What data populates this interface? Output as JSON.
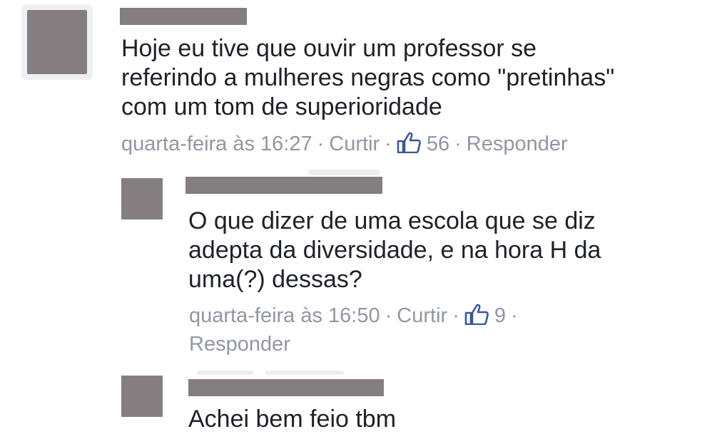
{
  "comments": [
    {
      "text": "Hoje eu tive que ouvir um professor se\nreferindo a mulheres negras como \"pretinhas\"\ncom um tom de superioridade",
      "timestamp": "quarta-feira às 16:27",
      "separator": "·",
      "like_label": "Curtir",
      "like_count": "56",
      "reply_label": "Responder"
    },
    {
      "text": "O que dizer de uma escola que se diz\nadepta da diversidade, e na hora H da\numa(?) dessas?",
      "timestamp": "quarta-feira às 16:50",
      "separator": "·",
      "like_label": "Curtir",
      "like_count": "9",
      "reply_label": "Responder"
    },
    {
      "text": "Achei bem feio tbm"
    }
  ],
  "colors": {
    "redaction": "#857e80",
    "meta_text": "#9197a3",
    "like_icon": "#3b5998",
    "body_text": "#1d2129"
  },
  "icons": {
    "like": "thumbs-up-icon"
  }
}
